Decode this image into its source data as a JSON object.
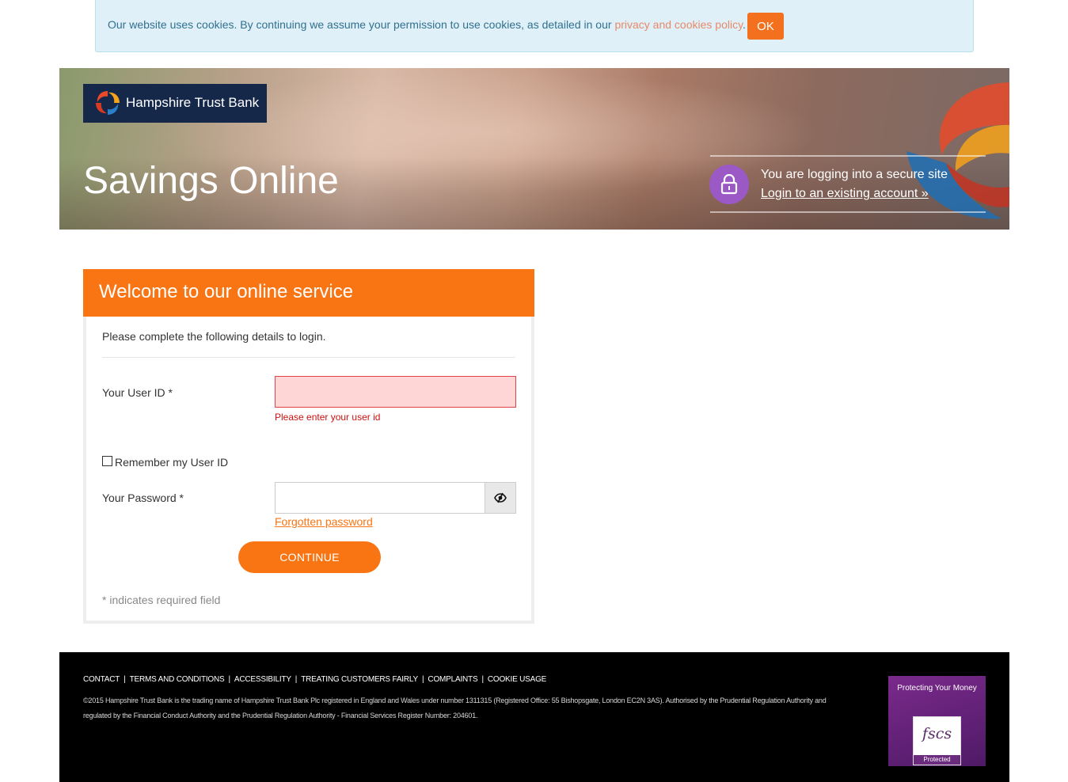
{
  "cookie_banner": {
    "text_before": "Our website uses cookies. By continuing we assume your permission to use cookies, as detailed in our ",
    "link_label": "privacy and cookies policy",
    "text_after": ".",
    "ok_label": "OK"
  },
  "hero": {
    "logo_text": "Hampshire Trust Bank",
    "title": "Savings Online",
    "secure_text": "You are logging into a secure site",
    "secure_link": "Login to an existing account »"
  },
  "login": {
    "header": "Welcome to our online service",
    "intro": "Please complete the following details to login.",
    "userid_label": "Your User ID *",
    "userid_value": "",
    "userid_error": "Please enter your user id",
    "remember_label": "Remember my User ID",
    "remember_checked": false,
    "password_label": "Your Password *",
    "password_value": "",
    "forgot_label": "Forgotten password",
    "continue_label": "CONTINUE",
    "required_note": "* indicates required field"
  },
  "footer": {
    "links": [
      "CONTACT",
      "TERMS AND CONDITIONS",
      "ACCESSIBILITY",
      "TREATING CUSTOMERS FAIRLY",
      "COMPLAINTS",
      "COOKIE USAGE"
    ],
    "separator": "|",
    "legal": "©2015 Hampshire Trust Bank is the trading name of Hampshire Trust Bank Plc registered in England and Wales under number 1311315 (Registered Office: 55 Bishopsgate, London EC2N 3AS). Authorised by the Prudential Regulation Authority and regulated by the Financial Conduct Authority and the Prudential Regulation Authority - Financial Services Register Number: 204601.",
    "fscs_title": "Protecting Your Money",
    "fscs_logo": "fscs",
    "fscs_protected": "Protected"
  },
  "colors": {
    "accent_orange": "#f97412",
    "brand_navy": "#15284a",
    "lock_purple": "#9b59c6",
    "error_red": "#cc1111",
    "cookie_bg": "#dff0f8"
  },
  "icons": {
    "logo": "hampshire-logo-icon",
    "lock": "lock-icon",
    "password_toggle": "eye-icon"
  }
}
